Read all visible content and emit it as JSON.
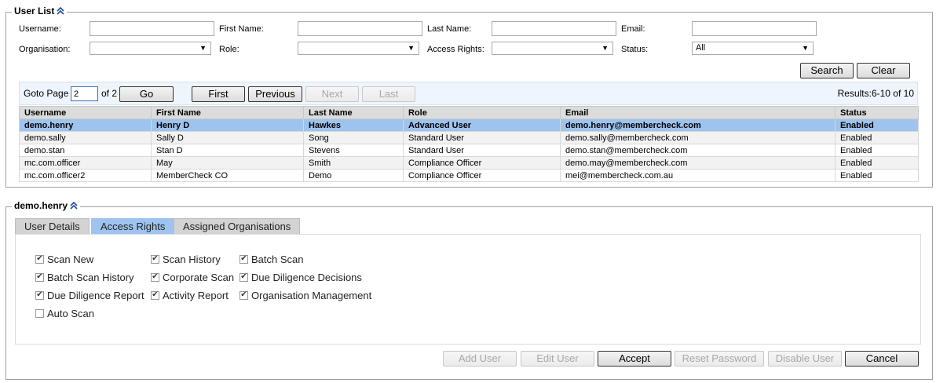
{
  "user_list": {
    "title": "User List",
    "filters": {
      "username_label": "Username:",
      "first_name_label": "First Name:",
      "last_name_label": "Last Name:",
      "email_label": "Email:",
      "organisation_label": "Organisation:",
      "role_label": "Role:",
      "access_rights_label": "Access Rights:",
      "status_label": "Status:",
      "status_value": "All",
      "search_label": "Search",
      "clear_label": "Clear"
    },
    "pager": {
      "goto_label": "Goto Page",
      "page_value": "2",
      "of_label": "of 2",
      "go_label": "Go",
      "first_label": "First",
      "previous_label": "Previous",
      "next_label": "Next",
      "last_label": "Last",
      "results": "Results:6-10 of 10"
    },
    "columns": [
      "Username",
      "First Name",
      "Last Name",
      "Role",
      "Email",
      "Status"
    ],
    "rows": [
      {
        "username": "demo.henry",
        "first_name": "Henry D",
        "last_name": "Hawkes",
        "role": "Advanced User",
        "email": "demo.henry@membercheck.com",
        "status": "Enabled"
      },
      {
        "username": "demo.sally",
        "first_name": "Sally D",
        "last_name": "Song",
        "role": "Standard User",
        "email": "demo.sally@membercheck.com",
        "status": "Enabled"
      },
      {
        "username": "demo.stan",
        "first_name": "Stan D",
        "last_name": "Stevens",
        "role": "Standard User",
        "email": "demo.stan@membercheck.com",
        "status": "Enabled"
      },
      {
        "username": "mc.com.officer",
        "first_name": "May",
        "last_name": "Smith",
        "role": "Compliance Officer",
        "email": "demo.may@membercheck.com",
        "status": "Enabled"
      },
      {
        "username": "mc.com.officer2",
        "first_name": "MemberCheck CO",
        "last_name": "Demo",
        "role": "Compliance Officer",
        "email": "mei@membercheck.com.au",
        "status": "Enabled"
      }
    ]
  },
  "detail": {
    "title": "demo.henry",
    "tabs": [
      "User Details",
      "Access Rights",
      "Assigned Organisations"
    ],
    "permissions": [
      {
        "label": "Scan New",
        "checked": true
      },
      {
        "label": "Scan History",
        "checked": true
      },
      {
        "label": "Batch Scan",
        "checked": true
      },
      {
        "label": "Batch Scan History",
        "checked": true
      },
      {
        "label": "Corporate Scan",
        "checked": true
      },
      {
        "label": "Due Diligence Decisions",
        "checked": true
      },
      {
        "label": "Due Diligence Report",
        "checked": true
      },
      {
        "label": "Activity Report",
        "checked": true
      },
      {
        "label": "Organisation Management",
        "checked": true
      },
      {
        "label": "Auto Scan",
        "checked": false
      }
    ],
    "actions": {
      "add_user": "Add User",
      "edit_user": "Edit User",
      "accept": "Accept",
      "reset_password": "Reset Password",
      "disable_user": "Disable User",
      "cancel": "Cancel"
    }
  },
  "icons": {
    "collapse": "double-chevron-up-icon",
    "dropdown": "triangle-down-icon",
    "check": "checkmark-icon"
  },
  "colors": {
    "selected_row": "#9ec3ee",
    "active_tab": "#9ec3ee",
    "pager_bg": "#eef5fc"
  }
}
